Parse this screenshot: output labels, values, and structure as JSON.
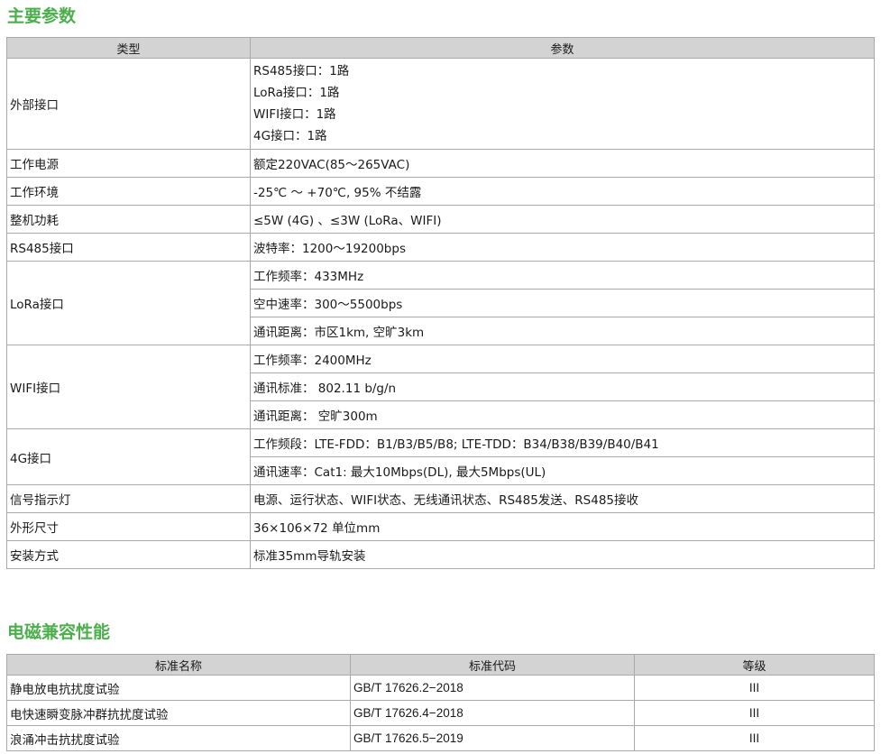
{
  "section1": {
    "title": "主要参数",
    "headers": [
      "类型",
      "参数"
    ],
    "rows": [
      {
        "type": "外部接口",
        "params": [
          "RS485接口：1路",
          "LoRa接口：1路",
          "WIFI接口：1路",
          "4G接口：1路"
        ]
      },
      {
        "type": "工作电源",
        "params": [
          "额定220VAC(85～265VAC)"
        ]
      },
      {
        "type": "工作环境",
        "params": [
          "-25℃ ～ +70℃, 95% 不结露"
        ]
      },
      {
        "type": "整机功耗",
        "params": [
          "≤5W (4G) 、≤3W (LoRa、WIFI)"
        ]
      },
      {
        "type": "RS485接口",
        "params": [
          "波特率：1200～19200bps"
        ]
      },
      {
        "type": "LoRa接口",
        "params": [
          "工作频率：433MHz",
          "空中速率：300～5500bps",
          "通讯距离：市区1km, 空旷3km"
        ]
      },
      {
        "type": "WIFI接口",
        "params": [
          "工作频率：2400MHz",
          "通讯标准： 802.11 b/g/n",
          "通讯距离： 空旷300m"
        ]
      },
      {
        "type": "4G接口",
        "params": [
          "工作频段：LTE-FDD：B1/B3/B5/B8; LTE-TDD：B34/B38/B39/B40/B41",
          "通讯速率：Cat1: 最大10Mbps(DL), 最大5Mbps(UL)"
        ]
      },
      {
        "type": "信号指示灯",
        "params": [
          "电源、运行状态、WIFI状态、无线通讯状态、RS485发送、RS485接收"
        ]
      },
      {
        "type": "外形尺寸",
        "params": [
          "36×106×72 单位mm"
        ]
      },
      {
        "type": "安装方式",
        "params": [
          "标准35mm导轨安装"
        ]
      }
    ]
  },
  "section2": {
    "title": "电磁兼容性能",
    "headers": [
      "标准名称",
      "标准代码",
      "等级"
    ],
    "rows": [
      {
        "name": "静电放电抗扰度试验",
        "code": "GB/T 17626.2−2018",
        "level": "III"
      },
      {
        "name": "电快速瞬变脉冲群抗扰度试验",
        "code": "GB/T 17626.4−2018",
        "level": "III"
      },
      {
        "name": "浪涌冲击抗扰度试验",
        "code": "GB/T 17626.5−2019",
        "level": "III"
      }
    ]
  },
  "colors": {
    "title": "#4cae4c",
    "header_bg": "#d3d3d3",
    "border": "#a9a9a9"
  }
}
